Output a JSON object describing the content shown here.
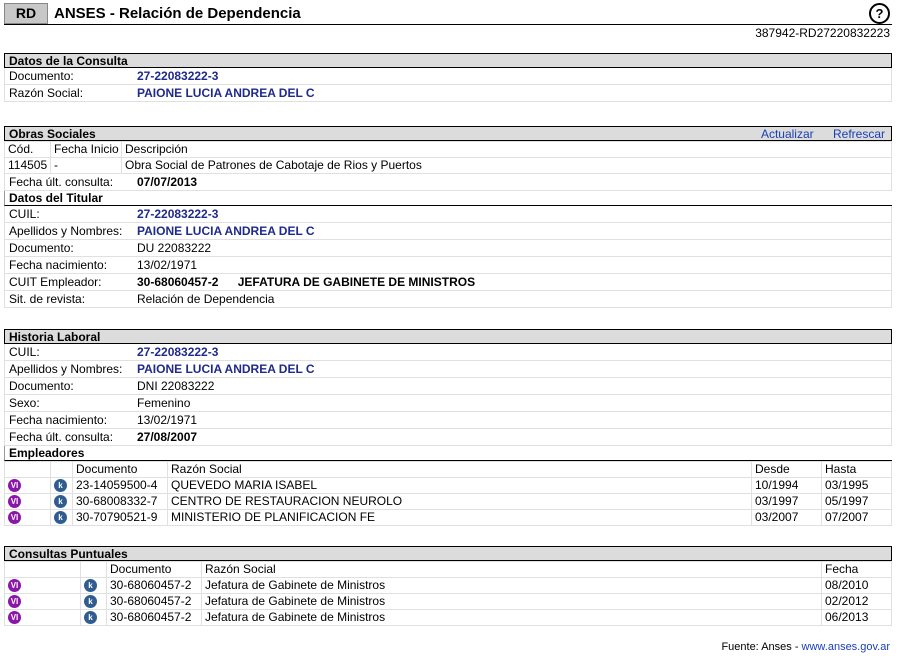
{
  "header": {
    "badge": "RD",
    "title": "ANSES - Relación de Dependencia",
    "help": "?",
    "ref": "387942-RD27220832223"
  },
  "consulta": {
    "title": "Datos de la Consulta",
    "documento_label": "Documento:",
    "documento": "27-22083222-3",
    "razon_label": "Razón Social:",
    "razon": "PAIONE LUCIA ANDREA DEL C"
  },
  "obras": {
    "title": "Obras Sociales",
    "actualizar": "Actualizar",
    "refrescar": "Refrescar",
    "cols": {
      "cod": "Cód.",
      "fecha": "Fecha Inicio",
      "desc": "Descripción"
    },
    "row": {
      "cod": "114505",
      "fecha": "-",
      "desc": "Obra Social de Patrones de Cabotaje de Rios y Puertos"
    },
    "ult_label": "Fecha últ. consulta:",
    "ult": "07/07/2013"
  },
  "titular": {
    "title": "Datos del Titular",
    "cuil_label": "CUIL:",
    "cuil": "27-22083222-3",
    "nombre_label": "Apellidos y Nombres:",
    "nombre": "PAIONE LUCIA ANDREA DEL C",
    "doc_label": "Documento:",
    "doc": "DU  22083222",
    "nac_label": "Fecha nacimiento:",
    "nac": "13/02/1971",
    "cuit_label": "CUIT Empleador:",
    "cuit": "30-68060457-2",
    "empleador": "JEFATURA DE GABINETE DE MINISTROS",
    "sit_label": "Sit. de revista:",
    "sit": "Relación de Dependencia"
  },
  "historia": {
    "title": "Historia Laboral",
    "cuil_label": "CUIL:",
    "cuil": "27-22083222-3",
    "nombre_label": "Apellidos y Nombres:",
    "nombre": "PAIONE LUCIA ANDREA DEL C",
    "doc_label": "Documento:",
    "doc": "DNI  22083222",
    "sexo_label": "Sexo:",
    "sexo": "Femenino",
    "nac_label": "Fecha nacimiento:",
    "nac": "13/02/1971",
    "ult_label": "Fecha últ. consulta:",
    "ult": "27/08/2007"
  },
  "empleadores": {
    "title": "Empleadores",
    "cols": {
      "doc": "Documento",
      "razon": "Razón Social",
      "desde": "Desde",
      "hasta": "Hasta"
    },
    "rows": [
      {
        "doc": "23-14059500-4",
        "razon": "QUEVEDO MARIA ISABEL",
        "desde": "10/1994",
        "hasta": "03/1995"
      },
      {
        "doc": "30-68008332-7",
        "razon": "CENTRO DE RESTAURACION NEUROLO",
        "desde": "03/1997",
        "hasta": "05/1997"
      },
      {
        "doc": "30-70790521-9",
        "razon": "MINISTERIO DE PLANIFICACION FE",
        "desde": "03/2007",
        "hasta": "07/2007"
      }
    ]
  },
  "consultas": {
    "title": "Consultas Puntuales",
    "cols": {
      "doc": "Documento",
      "razon": "Razón Social",
      "fecha": "Fecha"
    },
    "rows": [
      {
        "doc": "30-68060457-2",
        "razon": "Jefatura de Gabinete de Ministros",
        "fecha": "08/2010"
      },
      {
        "doc": "30-68060457-2",
        "razon": "Jefatura de Gabinete de Ministros",
        "fecha": "02/2012"
      },
      {
        "doc": "30-68060457-2",
        "razon": "Jefatura de Gabinete de Ministros",
        "fecha": "06/2013"
      }
    ]
  },
  "icons": {
    "vi": "VI",
    "info": "k"
  },
  "footer": {
    "fuente": "Fuente: Anses  -",
    "link": "www.anses.gov.ar"
  }
}
